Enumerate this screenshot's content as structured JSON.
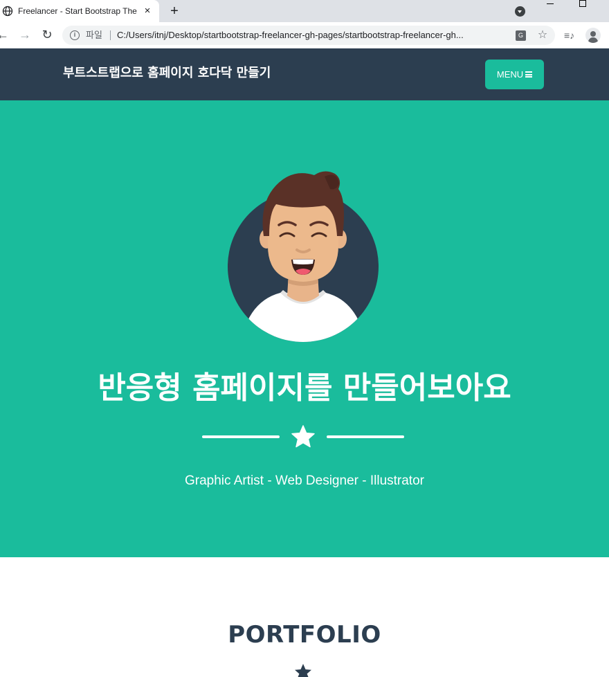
{
  "browser": {
    "tab_title": "Freelancer - Start Bootstrap The",
    "tab_close": "×",
    "new_tab": "+",
    "omnibox": {
      "scheme_label": "파일",
      "url": "C:/Users/itnj/Desktop/startbootstrap-freelancer-gh-pages/startbootstrap-freelancer-gh..."
    },
    "icons": [
      "globe-icon",
      "close-icon",
      "plus-icon",
      "tab-search-icon",
      "back-icon",
      "forward-icon",
      "reload-icon",
      "info-icon",
      "translate-icon",
      "star-icon",
      "media-icon",
      "profile-icon"
    ]
  },
  "navbar": {
    "brand": "부트스트랩으로 홈페이지 호다닥 만들기",
    "menu_label": "MENU"
  },
  "masthead": {
    "title": "반응형 홈페이지를 만들어보아요",
    "subtitle": "Graphic Artist - Web Designer - Illustrator"
  },
  "portfolio": {
    "title": "PORTFOLIO"
  },
  "colors": {
    "navbar": "#2c3e50",
    "primary": "#1abc9c",
    "text_dark": "#2c3e50"
  }
}
